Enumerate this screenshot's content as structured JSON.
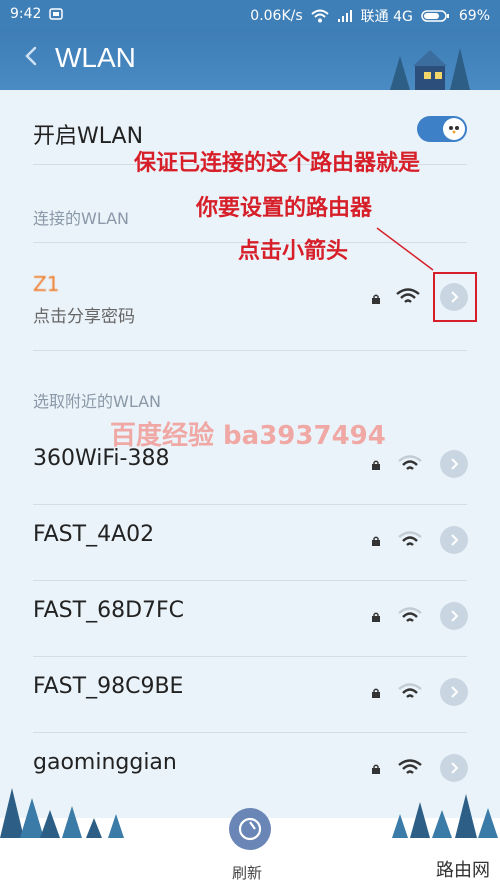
{
  "statusbar": {
    "time": "9:42",
    "speed": "0.06K/s",
    "carrier": "联通 4G",
    "battery": "69%"
  },
  "header": {
    "title": "WLAN"
  },
  "toggle": {
    "label": "开启WLAN",
    "state": "on"
  },
  "sections": {
    "connected_title": "连接的WLAN",
    "nearby_title": "选取附近的WLAN"
  },
  "connected": {
    "name": "Z⁢⁢⁢⁢⁢1",
    "subtitle": "点击分享密码"
  },
  "nearby": [
    {
      "name": "360WiFi-388"
    },
    {
      "name": "FAST_4A02"
    },
    {
      "name": "FAST_68D7FC"
    },
    {
      "name": "FAST_98C9BE"
    },
    {
      "name": "gaominggian"
    }
  ],
  "annotations": {
    "line1": "保证已连接的这个路由器就是",
    "line2": "你要设置的路由器",
    "line3": "点击小箭头"
  },
  "watermark": "百度经验 ba3937494",
  "footer": {
    "refresh": "刷新",
    "brand": "路由网"
  },
  "colors": {
    "header": "#3e7db6",
    "accent": "#3e80c8",
    "annotation": "#d71f2a"
  }
}
